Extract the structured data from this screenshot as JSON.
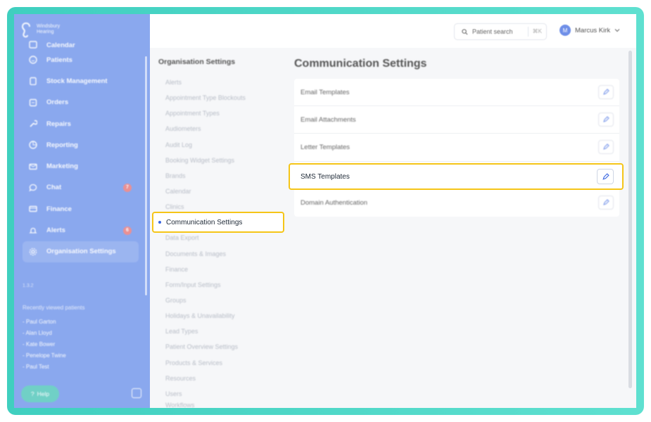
{
  "brand": {
    "line1": "Windsbury",
    "line2": "Hearing"
  },
  "sidebar": {
    "items": [
      {
        "label": "Calendar",
        "icon": "calendar-icon"
      },
      {
        "label": "Patients",
        "icon": "smile-icon"
      },
      {
        "label": "Stock Management",
        "icon": "clipboard-icon"
      },
      {
        "label": "Orders",
        "icon": "orders-icon"
      },
      {
        "label": "Repairs",
        "icon": "wrench-icon"
      },
      {
        "label": "Reporting",
        "icon": "pie-chart-icon"
      },
      {
        "label": "Marketing",
        "icon": "mail-icon"
      },
      {
        "label": "Chat",
        "icon": "chat-icon",
        "badge": "7"
      },
      {
        "label": "Finance",
        "icon": "card-icon"
      },
      {
        "label": "Alerts",
        "icon": "bell-icon",
        "badge": "6"
      },
      {
        "label": "Organisation Settings",
        "icon": "gear-icon",
        "active": true
      }
    ],
    "version": "1.3.2",
    "recent_title": "Recently viewed patients",
    "recent": [
      "- Paul Garton",
      "- Alan Lloyd",
      "- Kate Bower",
      "- Penelope Twine",
      "- Paul Test"
    ],
    "help_label": "Help"
  },
  "topbar": {
    "search_label": "Patient search",
    "search_shortcut": "⌘K",
    "user_initial": "M",
    "user_name": "Marcus Kirk"
  },
  "settings": {
    "title": "Organisation Settings",
    "items": [
      "Alerts",
      "Appointment Type Blockouts",
      "Appointment Types",
      "Audiometers",
      "Audit Log",
      "Booking Widget Settings",
      "Brands",
      "Calendar",
      "Clinics",
      "Communication Settings",
      "Data Export",
      "Documents & Images",
      "Finance",
      "Form/Input Settings",
      "Groups",
      "Holidays & Unavailability",
      "Lead Types",
      "Patient Overview Settings",
      "Products & Services",
      "Resources",
      "Users",
      "Workflows"
    ],
    "active_label": "Communication Settings"
  },
  "main": {
    "title": "Communication Settings",
    "rows": [
      {
        "label": "Email Templates"
      },
      {
        "label": "Email Attachments"
      },
      {
        "label": "Letter Templates"
      },
      {
        "label": "SMS Templates"
      },
      {
        "label": "Domain Authentication"
      }
    ],
    "highlighted_label": "SMS Templates"
  },
  "colors": {
    "sidebar": "#8aa8ee",
    "highlight": "#f5c518",
    "frame": "#3fcfbf",
    "accent": "#3a66e0"
  }
}
